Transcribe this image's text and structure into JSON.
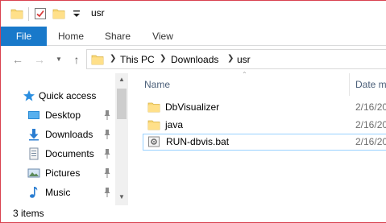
{
  "window": {
    "title": "usr",
    "accent_color": "#1979ca",
    "border_color": "#d9414f"
  },
  "quick_access_toolbar": {
    "icons": [
      "folder-icon",
      "properties-checkmark-icon",
      "new-folder-icon",
      "customize-dropdown-icon"
    ]
  },
  "ribbon": {
    "tabs": [
      {
        "label": "File"
      },
      {
        "label": "Home"
      },
      {
        "label": "Share"
      },
      {
        "label": "View"
      }
    ]
  },
  "address_bar": {
    "breadcrumbs": [
      "This PC",
      "Downloads",
      "usr"
    ]
  },
  "navigation_pane": {
    "items": [
      {
        "label": "Quick access",
        "icon": "star-icon",
        "pinned": false
      },
      {
        "label": "Desktop",
        "icon": "desktop-icon",
        "pinned": true
      },
      {
        "label": "Downloads",
        "icon": "download-arrow-icon",
        "pinned": true
      },
      {
        "label": "Documents",
        "icon": "documents-icon",
        "pinned": true
      },
      {
        "label": "Pictures",
        "icon": "pictures-icon",
        "pinned": true
      },
      {
        "label": "Music",
        "icon": "music-note-icon",
        "pinned": true
      }
    ]
  },
  "file_list": {
    "columns": [
      {
        "label": "Name"
      },
      {
        "label": "Date m"
      }
    ],
    "files": [
      {
        "name": "DbVisualizer",
        "type": "folder",
        "date": "2/16/20"
      },
      {
        "name": "java",
        "type": "folder",
        "date": "2/16/20"
      },
      {
        "name": "RUN-dbvis.bat",
        "type": "batch-file",
        "date": "2/16/20",
        "selected": true
      }
    ]
  },
  "status_bar": {
    "item_count": "3 items"
  }
}
